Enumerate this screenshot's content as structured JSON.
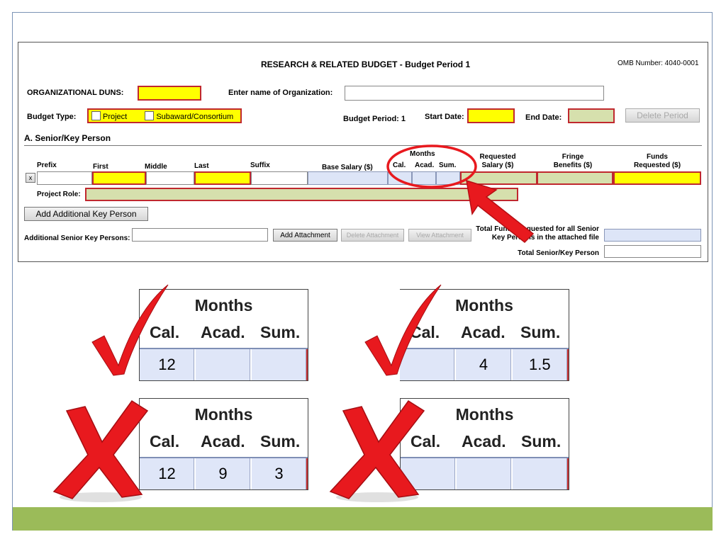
{
  "form": {
    "title": "RESEARCH & RELATED BUDGET - Budget Period 1",
    "omb": "OMB Number: 4040-0001",
    "duns_label": "ORGANIZATIONAL DUNS:",
    "org_label": "Enter name of Organization:",
    "budget_type_label": "Budget Type:",
    "project_option": "Project",
    "subaward_option": "Subaward/Consortium",
    "budget_period_label": "Budget Period: 1",
    "start_date_label": "Start Date:",
    "end_date_label": "End Date:",
    "delete_period": "Delete Period",
    "section_title": "A. Senior/Key Person",
    "columns": {
      "prefix": "Prefix",
      "first": "First",
      "middle": "Middle",
      "last": "Last",
      "suffix": "Suffix",
      "base_salary": "Base Salary ($)",
      "months": "Months",
      "cal": "Cal.",
      "acad": "Acad.",
      "sum": "Sum.",
      "requested_salary_1": "Requested",
      "requested_salary_2": "Salary ($)",
      "fringe_1": "Fringe",
      "fringe_2": "Benefits ($)",
      "funds_1": "Funds",
      "funds_2": "Requested ($)"
    },
    "remove_row": "x",
    "project_role_label": "Project Role:",
    "add_key_person": "Add Additional Key Person",
    "additional_label": "Additional Senior Key Persons:",
    "add_attachment": "Add Attachment",
    "delete_attachment": "Delete Attachment",
    "view_attachment": "View Attachment",
    "total_funds_label_1": "Total Funds Requested for all Senior",
    "total_funds_label_2": "Key Persons in the attached file",
    "total_senior_label": "Total Senior/Key Person"
  },
  "examples": [
    {
      "months": "Months",
      "cal": "Cal.",
      "acad": "Acad.",
      "sum": "Sum.",
      "values": [
        "12",
        "",
        ""
      ],
      "verdict": "correct"
    },
    {
      "months": "Months",
      "cal": "Cal.",
      "acad": "Acad.",
      "sum": "Sum.",
      "values": [
        "",
        "4",
        "1.5"
      ],
      "verdict": "correct"
    },
    {
      "months": "Months",
      "cal": "Cal.",
      "acad": "Acad.",
      "sum": "Sum.",
      "values": [
        "12",
        "9",
        "3"
      ],
      "verdict": "incorrect"
    },
    {
      "months": "Months",
      "cal": "Cal.",
      "acad": "Acad.",
      "sum": "Sum.",
      "values": [
        "",
        "",
        ""
      ],
      "verdict": "incorrect"
    }
  ],
  "colors": {
    "required_field": "#ffff00",
    "required_border": "#c0282e",
    "optional_field": "#d6e0ad",
    "calc_field": "#dde5f7",
    "annotation_red": "#e8191e",
    "footer_bar": "#9bbb59"
  },
  "icons": [
    "checkmark-icon",
    "x-mark-icon",
    "arrow-icon",
    "circle-highlight"
  ]
}
